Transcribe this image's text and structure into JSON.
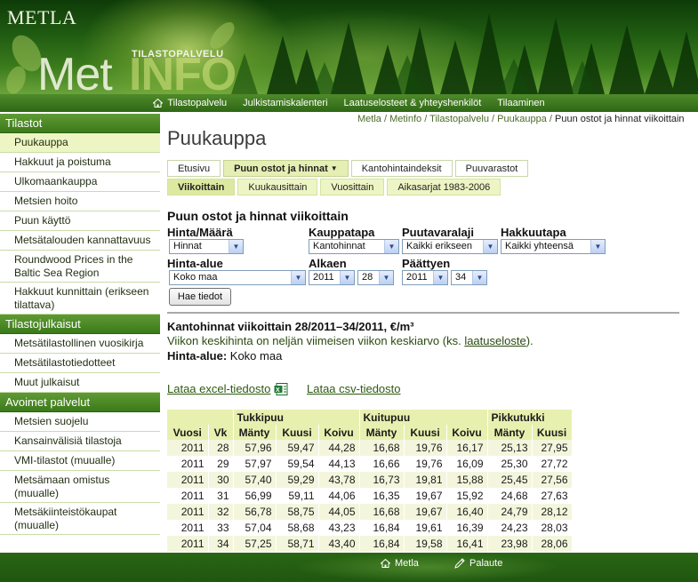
{
  "header": {
    "brand_top": "METLA",
    "brand_sub": "TILASTOPALVELU",
    "brand_met": "Met",
    "brand_info": "INFO"
  },
  "topnav": {
    "items": [
      "Tilastopalvelu",
      "Julkistamiskalenteri",
      "Laatuselosteet & yhteyshenkilöt",
      "Tilaaminen"
    ]
  },
  "sidebar": {
    "sections": [
      {
        "title": "Tilastot",
        "items": [
          "Puukauppa",
          "Hakkuut ja poistuma",
          "Ulkomaankauppa",
          "Metsien hoito",
          "Puun käyttö",
          "Metsätalouden kannattavuus",
          "Roundwood Prices in the Baltic Sea Region",
          "Hakkuut kunnittain (erikseen tilattava)"
        ]
      },
      {
        "title": "Tilastojulkaisut",
        "items": [
          "Metsätilastollinen vuosikirja",
          "Metsätilastotiedotteet",
          "Muut julkaisut"
        ]
      },
      {
        "title": "Avoimet palvelut",
        "items": [
          "Metsien suojelu",
          "Kansainvälisiä tilastoja",
          "VMI-tilastot (muualle)",
          "Metsämaan omistus (muualle)",
          "Metsäkiinteistökaupat (muualle)"
        ]
      }
    ]
  },
  "breadcrumb": {
    "links": [
      "Metla",
      "Metinfo",
      "Tilastopalvelu",
      "Puukauppa"
    ],
    "separator": " / ",
    "current": "Puun ostot ja hinnat viikoittain"
  },
  "page_title": "Puukauppa",
  "tabs": {
    "main": [
      "Etusivu",
      "Puun ostot ja hinnat",
      "Kantohintaindeksit",
      "Puuvarastot"
    ],
    "sub": [
      "Viikoittain",
      "Kuukausittain",
      "Vuosittain",
      "Aikasarjat 1983-2006"
    ]
  },
  "form": {
    "title": "Puun ostot ja hinnat viikoittain",
    "hinta_maara_label": "Hinta/Määrä",
    "hinta_maara_value": "Hinnat",
    "kauppatapa_label": "Kauppatapa",
    "kauppatapa_value": "Kantohinnat",
    "puutavaralaji_label": "Puutavaralaji",
    "puutavaralaji_value": "Kaikki erikseen",
    "hakkuutapa_label": "Hakkuutapa",
    "hakkuutapa_value": "Kaikki yhteensä",
    "hinta_alue_label": "Hinta-alue",
    "hinta_alue_value": "Koko maa",
    "alkaen_label": "Alkaen",
    "alkaen_year": "2011",
    "alkaen_week": "28",
    "paattyen_label": "Päättyen",
    "paattyen_year": "2011",
    "paattyen_week": "34",
    "submit": "Hae tiedot"
  },
  "result": {
    "title": "Kantohinnat viikoittain 28/2011–34/2011, €/m³",
    "note_text": "Viikon keskihinta on neljän viimeisen viikon keskiarvo (ks. ",
    "note_link": "laatuseloste",
    "note_end": ").",
    "area_label": "Hinta-alue:",
    "area_value": " Koko maa",
    "excel_link": "Lataa excel-tiedosto",
    "csv_link": "Lataa csv-tiedosto"
  },
  "table": {
    "groups": [
      "Tukkipuu",
      "Kuitupuu",
      "Pikkutukki"
    ],
    "columns": [
      "Vuosi",
      "Vk",
      "Mänty",
      "Kuusi",
      "Koivu",
      "Mänty",
      "Kuusi",
      "Koivu",
      "Mänty",
      "Kuusi"
    ],
    "rows": [
      [
        "2011",
        "28",
        "57,96",
        "59,47",
        "44,28",
        "16,68",
        "19,76",
        "16,17",
        "25,13",
        "27,95"
      ],
      [
        "2011",
        "29",
        "57,97",
        "59,54",
        "44,13",
        "16,66",
        "19,76",
        "16,09",
        "25,30",
        "27,72"
      ],
      [
        "2011",
        "30",
        "57,40",
        "59,29",
        "43,78",
        "16,73",
        "19,81",
        "15,88",
        "25,45",
        "27,56"
      ],
      [
        "2011",
        "31",
        "56,99",
        "59,11",
        "44,06",
        "16,35",
        "19,67",
        "15,92",
        "24,68",
        "27,63"
      ],
      [
        "2011",
        "32",
        "56,78",
        "58,75",
        "44,05",
        "16,68",
        "19,67",
        "16,40",
        "24,79",
        "28,12"
      ],
      [
        "2011",
        "33",
        "57,04",
        "58,68",
        "43,23",
        "16,84",
        "19,61",
        "16,39",
        "24,23",
        "28,03"
      ],
      [
        "2011",
        "34",
        "57,25",
        "58,71",
        "43,40",
        "16,84",
        "19,58",
        "16,41",
        "23,98",
        "28,06"
      ]
    ]
  },
  "footer": {
    "home": "Metla",
    "feedback": "Palaute"
  }
}
